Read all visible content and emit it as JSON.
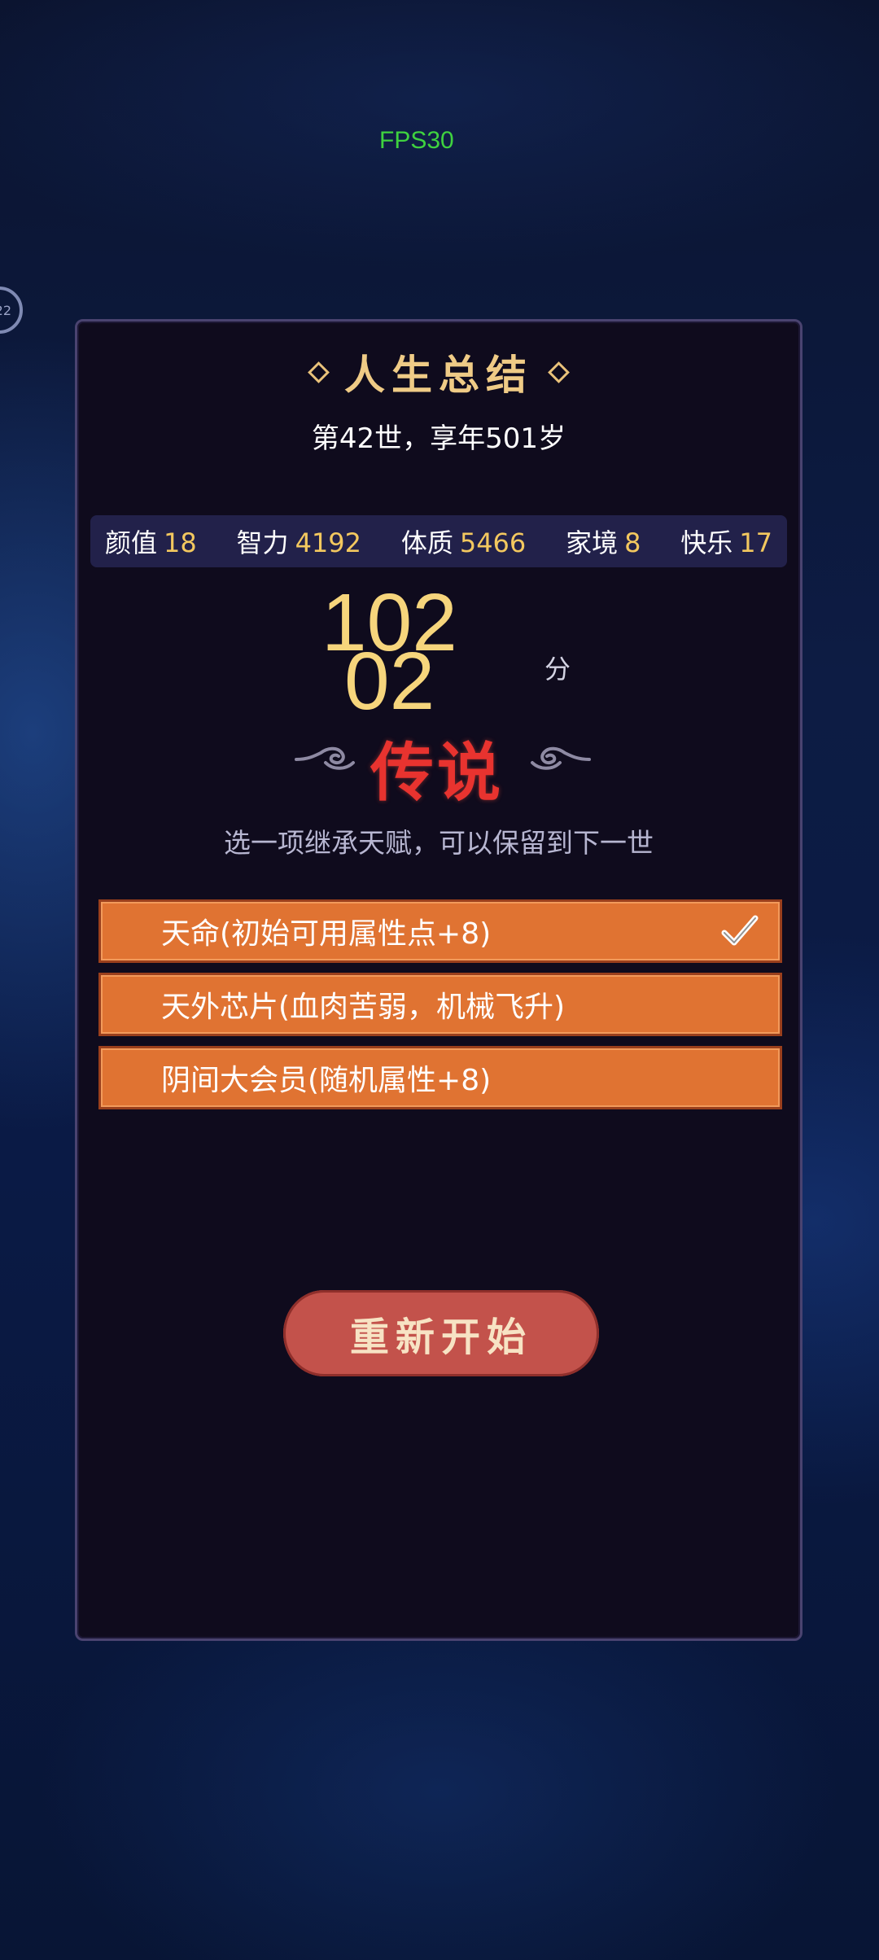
{
  "overlay": {
    "fps": "FPS30",
    "side_badge": "22"
  },
  "summary": {
    "title": "人生总结",
    "subtitle": "第42世，享年501岁"
  },
  "stats": [
    {
      "label": "颜值",
      "value": "18"
    },
    {
      "label": "智力",
      "value": "4192"
    },
    {
      "label": "体质",
      "value": "5466"
    },
    {
      "label": "家境",
      "value": "8"
    },
    {
      "label": "快乐",
      "value": "17"
    }
  ],
  "score": {
    "line1": "102",
    "line2": "02",
    "unit": "分",
    "rank": "传说"
  },
  "inherit": {
    "hint": "选一项继承天赋，可以保留到下一世",
    "options": [
      {
        "label": "天命(初始可用属性点+8)",
        "selected": true
      },
      {
        "label": "天外芯片(血肉苦弱，机械飞升)",
        "selected": false
      },
      {
        "label": "阴间大会员(随机属性+8)",
        "selected": false
      }
    ]
  },
  "actions": {
    "restart_label": "重新开始"
  },
  "colors": {
    "gold": "#f3c85f",
    "option_orange": "#e07332",
    "rank_red": "#e8332f",
    "button_red": "#c3524b"
  }
}
